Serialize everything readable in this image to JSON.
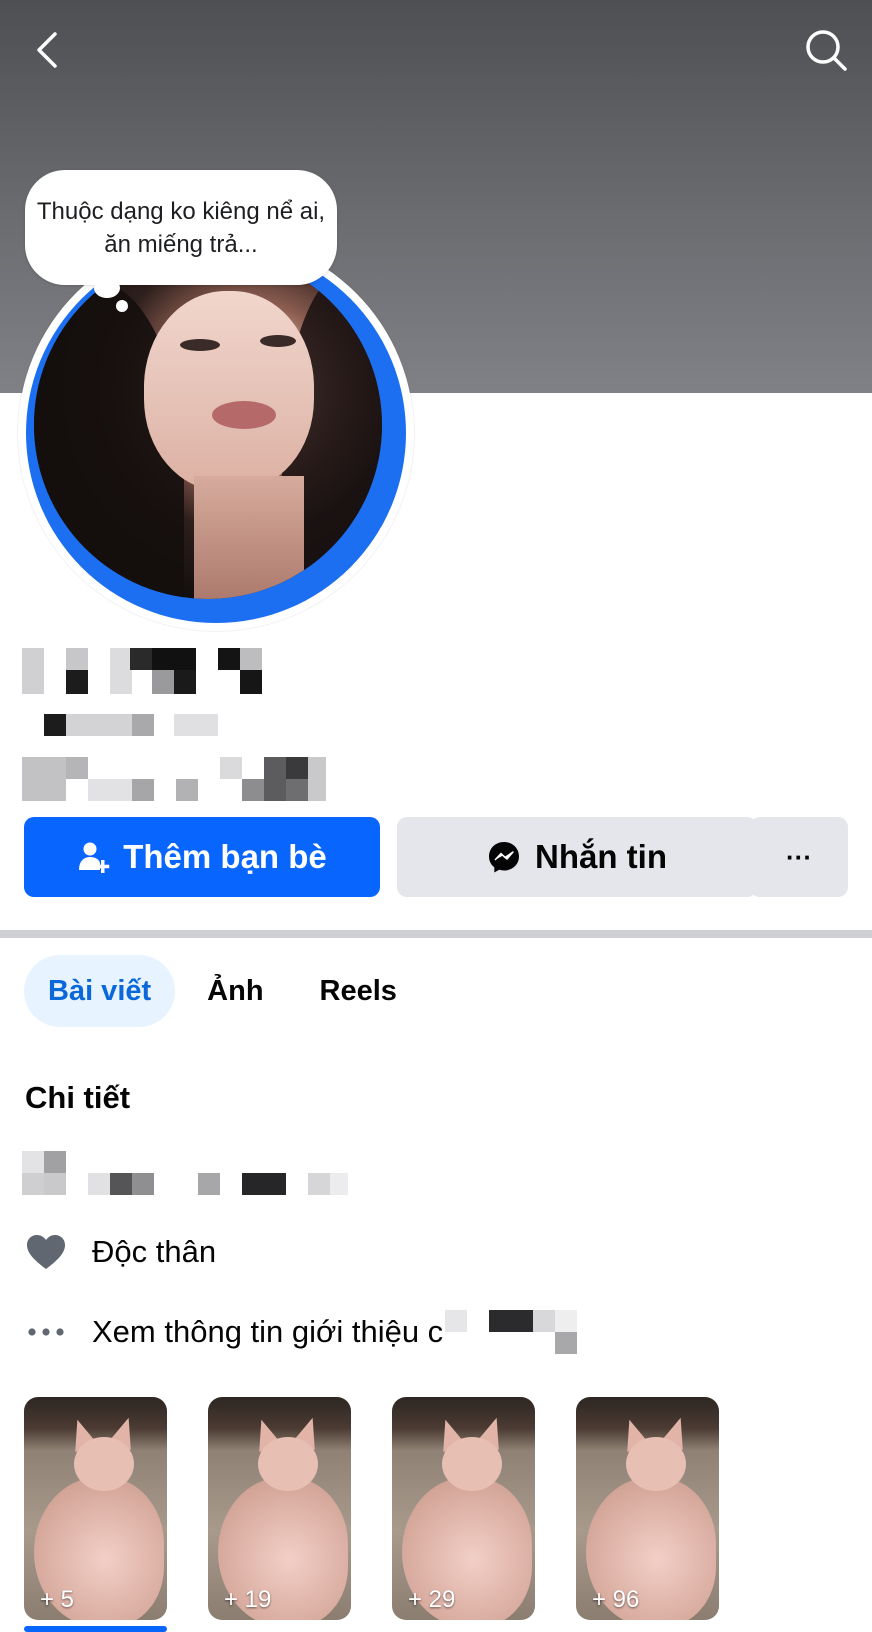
{
  "header": {
    "back_icon": "chevron-left-icon",
    "search_icon": "search-icon"
  },
  "profile": {
    "note_bubble": "Thuộc dạng ko kiêng nể ai, ăn miếng trả...",
    "name": "",
    "subtitle": "",
    "stats": ""
  },
  "actions": {
    "add_friend": "Thêm bạn bè",
    "add_friend_icon": "add-person-icon",
    "message": "Nhắn tin",
    "message_icon": "messenger-icon",
    "more": "···"
  },
  "tabs": [
    {
      "label": "Bài viết",
      "active": true
    },
    {
      "label": "Ảnh",
      "active": false
    },
    {
      "label": "Reels",
      "active": false
    }
  ],
  "details": {
    "title": "Chi tiết",
    "relationship": "Độc thân",
    "relationship_icon": "heart-icon",
    "see_about": "Xem thông tin giới thiệu c",
    "see_about_icon": "more-horizontal-icon"
  },
  "highlights": [
    {
      "count": "+ 5"
    },
    {
      "count": "+ 19"
    },
    {
      "count": "+ 29"
    },
    {
      "count": "+ 96"
    }
  ],
  "colors": {
    "accent": "#0866ff",
    "secondary_button": "#e4e6eb",
    "active_tab_bg": "#e7f3ff",
    "active_tab_text": "#0a68d8"
  }
}
